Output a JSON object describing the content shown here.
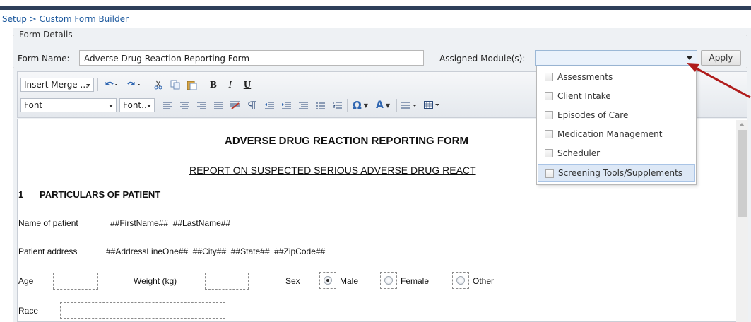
{
  "breadcrumb": "Setup > Custom Form Builder",
  "form_details": {
    "legend": "Form Details",
    "form_name_label": "Form Name:",
    "form_name_value": "Adverse Drug Reaction Reporting Form",
    "assigned_module_label": "Assigned Module(s):",
    "assigned_module_value": "",
    "apply_label": "Apply"
  },
  "toolbar": {
    "insert_merge_label": "Insert Merge ...",
    "font_label": "Font",
    "font_size_label": "Font..",
    "bold": "B",
    "italic": "I",
    "underline": "U",
    "omega": "Ω",
    "font_color": "A"
  },
  "modules": [
    {
      "label": "Assessments",
      "checked": false,
      "highlighted": false
    },
    {
      "label": "Client Intake",
      "checked": false,
      "highlighted": false
    },
    {
      "label": "Episodes of Care",
      "checked": false,
      "highlighted": false
    },
    {
      "label": "Medication Management",
      "checked": false,
      "highlighted": false
    },
    {
      "label": "Scheduler",
      "checked": false,
      "highlighted": false
    },
    {
      "label": "Screening Tools/Supplements",
      "checked": false,
      "highlighted": true
    }
  ],
  "document": {
    "title": "ADVERSE DRUG REACTION REPORTING FORM",
    "subtitle": "REPORT ON SUSPECTED SERIOUS ADVERSE DRUG REACT",
    "section_number": "1",
    "section_title": "PARTICULARS OF PATIENT",
    "name_label": "Name of patient",
    "name_merge": "##FirstName##  ##LastName##",
    "address_label": "Patient address",
    "address_merge": "##AddressLineOne##  ##City##  ##State##  ##ZipCode##",
    "age_label": "Age",
    "weight_label": "Weight (kg)",
    "sex_label": "Sex",
    "sex_options": [
      "Male",
      "Female",
      "Other"
    ],
    "sex_selected": "Male",
    "race_label": "Race"
  },
  "colors": {
    "accent_arrow": "#b01c1c",
    "breadcrumb_link": "#1e5a9e",
    "header_bar": "#2e3f5a",
    "highlight": "#dde8f6"
  }
}
